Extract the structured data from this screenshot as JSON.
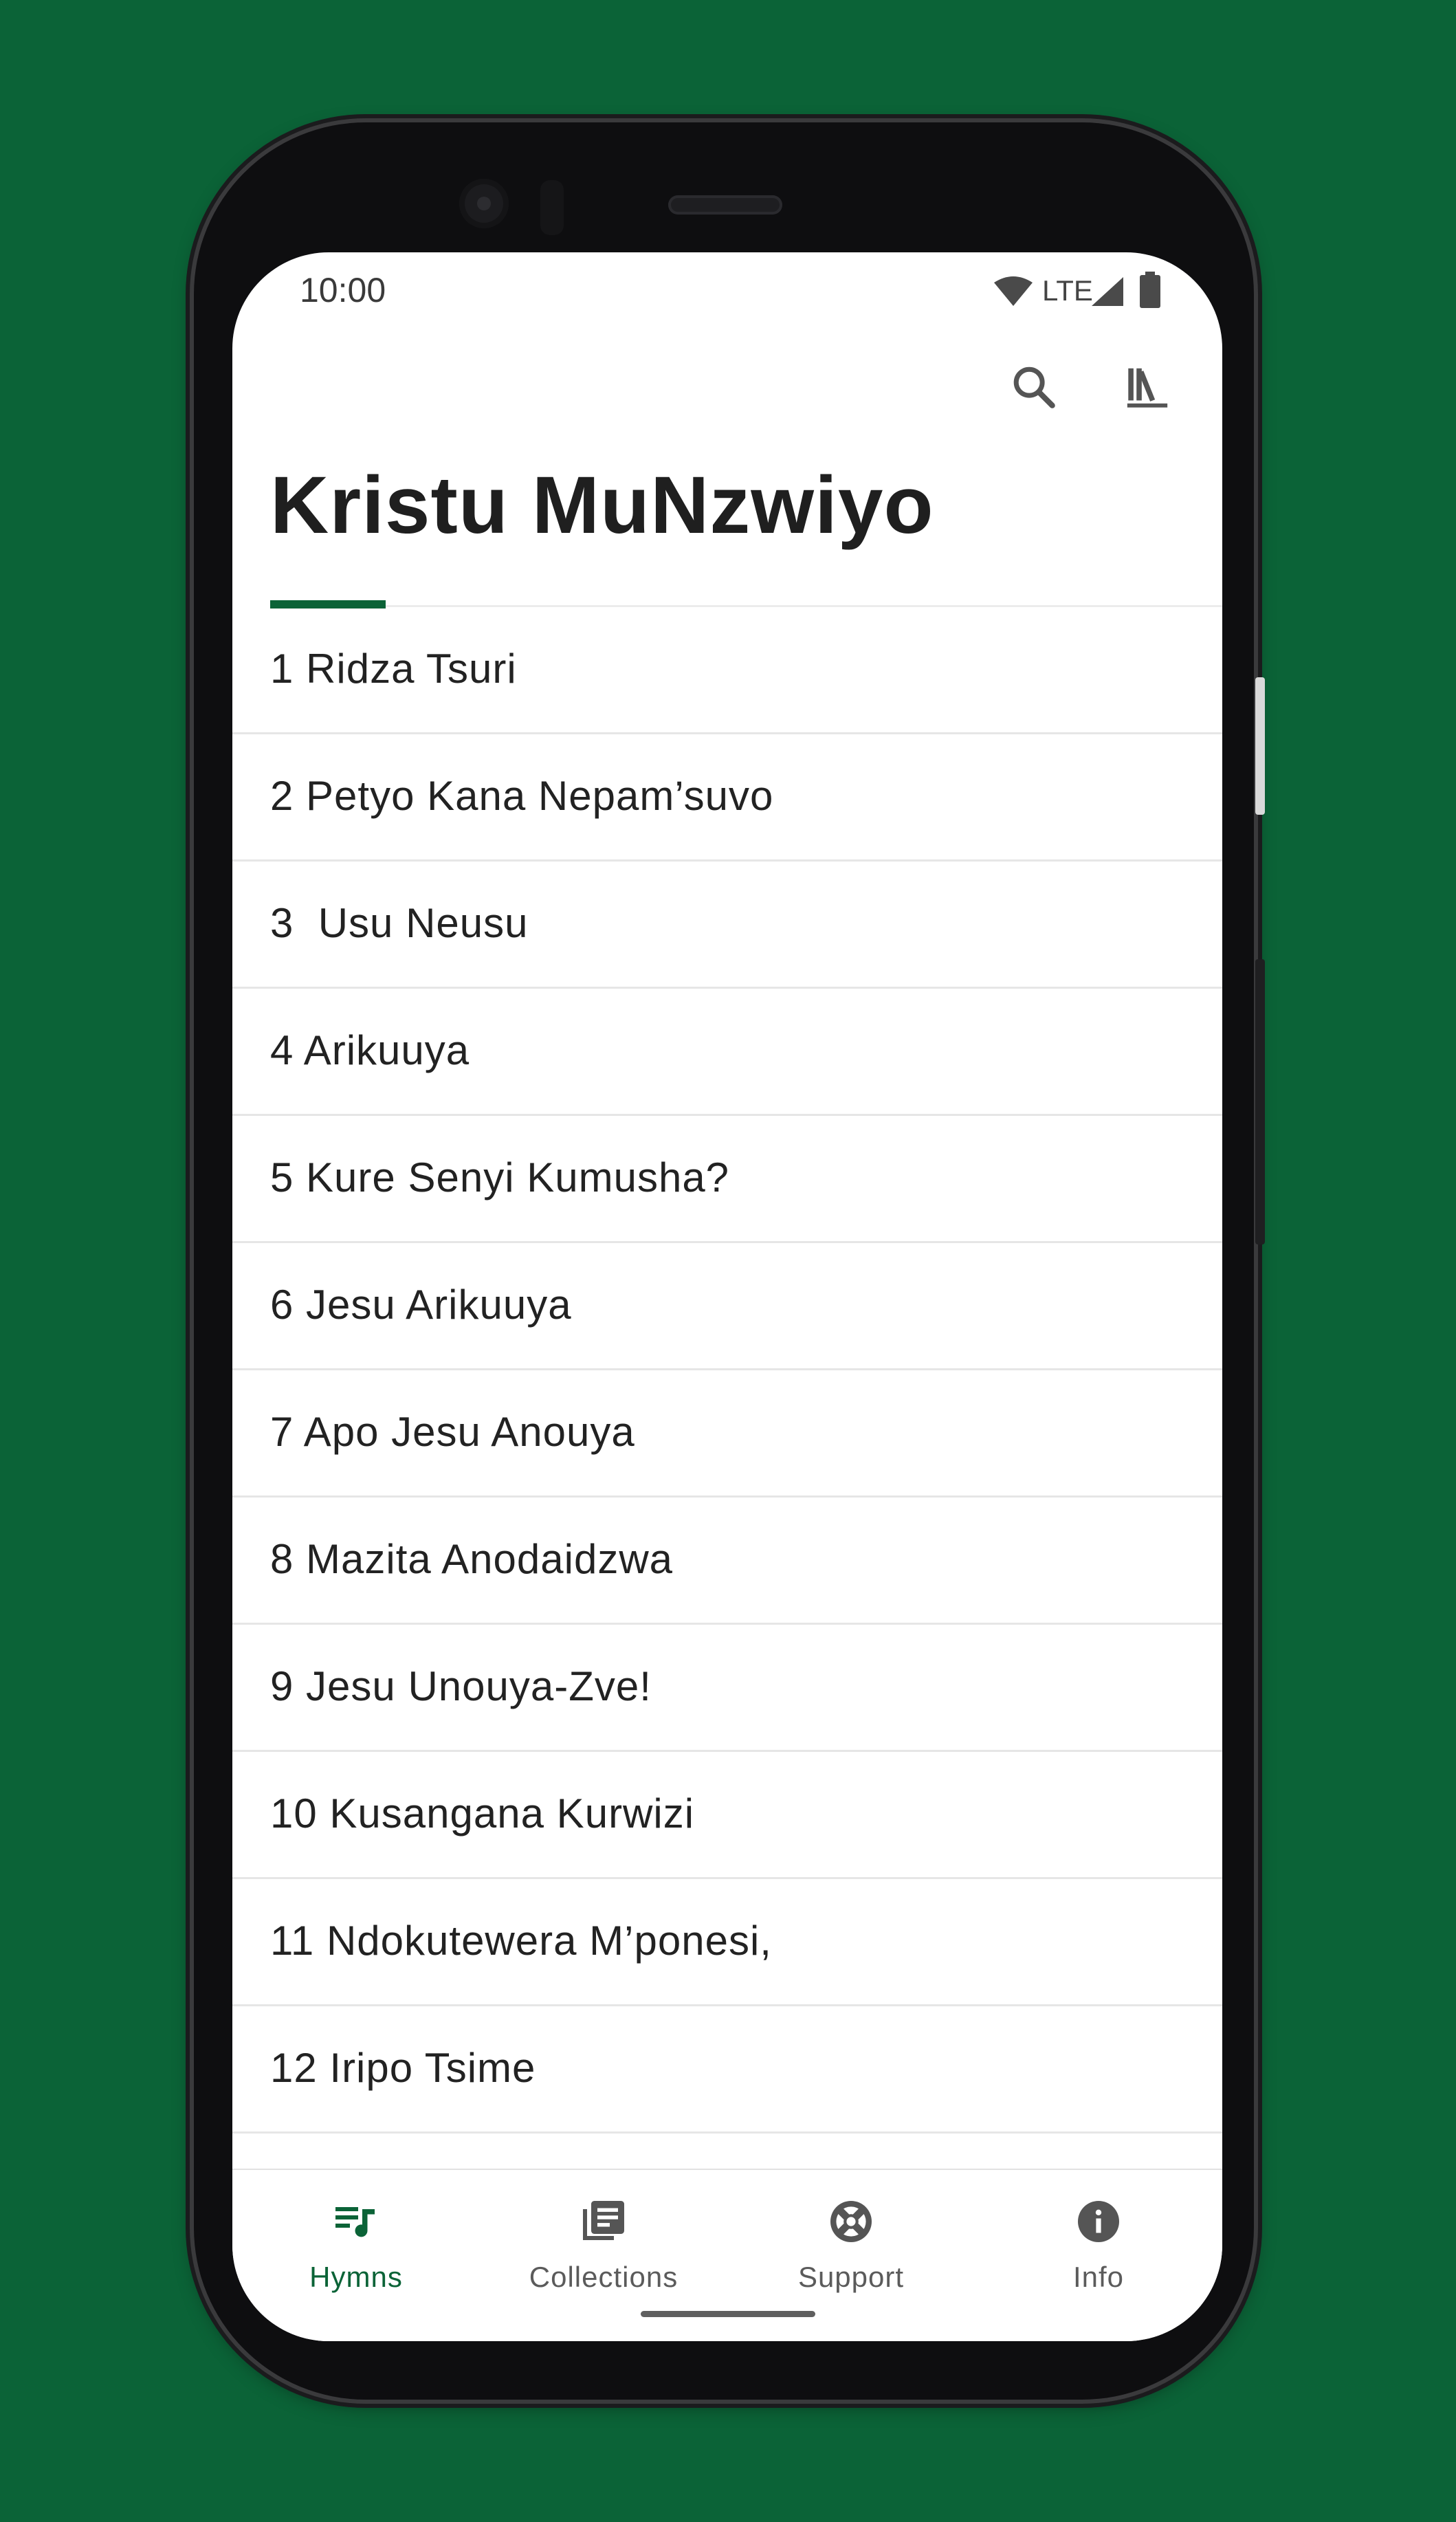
{
  "status_bar": {
    "time": "10:00",
    "network": "LTE"
  },
  "header": {
    "title": "Kristu MuNzwiyo"
  },
  "top_actions": [
    {
      "name": "search",
      "icon": "search-icon"
    },
    {
      "name": "library",
      "icon": "library-icon"
    }
  ],
  "hymns": [
    "1 Ridza Tsuri",
    "2 Petyo Kana Nepam’suvo",
    "3  Usu Neusu",
    "4 Arikuuya",
    "5 Kure Senyi Kumusha?",
    "6 Jesu Arikuuya",
    "7 Apo Jesu Anouya",
    "8 Mazita Anodaidzwa",
    "9 Jesu Unouya-Zve!",
    "10 Kusangana Kurwizi",
    "11 Ndokutewera M’ponesi,",
    "12 Iripo Tsime"
  ],
  "nav": [
    {
      "label": "Hymns",
      "icon": "hymns-icon",
      "active": true
    },
    {
      "label": "Collections",
      "icon": "collections-icon",
      "active": false
    },
    {
      "label": "Support",
      "icon": "support-icon",
      "active": false
    },
    {
      "label": "Info",
      "icon": "info-icon",
      "active": false
    }
  ],
  "colors": {
    "brand": "#0b6337",
    "background": "#0b6337",
    "text": "#222222"
  }
}
